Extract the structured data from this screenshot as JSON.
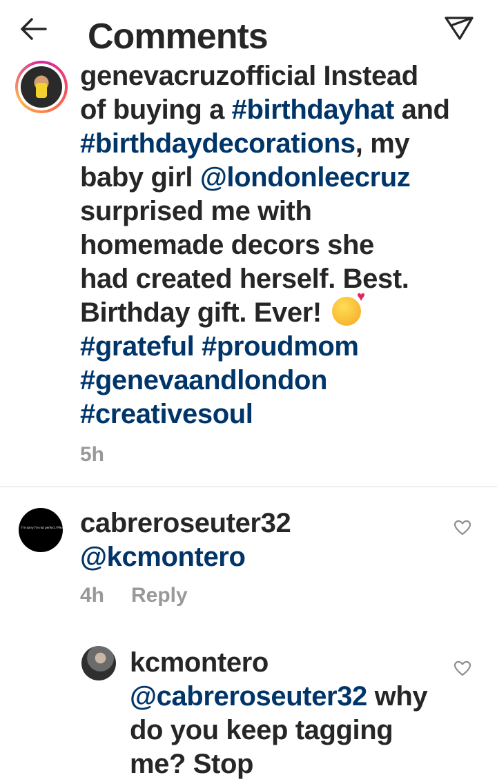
{
  "header": {
    "title": "Comments",
    "back_icon": "arrow-left-icon",
    "share_icon": "paper-plane-icon"
  },
  "caption": {
    "lines": [
      [
        {
          "t": "genevacruzofficial Instead",
          "tag": false
        }
      ],
      [
        {
          "t": "of buying a ",
          "tag": false
        },
        {
          "t": "#birthdayhat",
          "tag": true
        },
        {
          "t": " and",
          "tag": false
        }
      ],
      [
        {
          "t": "#birthdaydecorations",
          "tag": true
        },
        {
          "t": ", my",
          "tag": false
        }
      ],
      [
        {
          "t": "baby girl ",
          "tag": false
        },
        {
          "t": "@londonleecruz",
          "tag": true
        }
      ],
      [
        {
          "t": "surprised me with",
          "tag": false
        }
      ],
      [
        {
          "t": "homemade decors she",
          "tag": false
        }
      ],
      [
        {
          "t": "had created herself. Best.",
          "tag": false
        }
      ],
      [
        {
          "t": "Birthday gift. Ever! ",
          "tag": false
        },
        {
          "emoji": "smiling-face-with-hearts-icon"
        }
      ],
      [
        {
          "t": "#grateful",
          "tag": true
        },
        {
          "t": " ",
          "tag": false
        },
        {
          "t": "#proudmom",
          "tag": true
        }
      ],
      [
        {
          "t": "#genevaandlondon",
          "tag": true
        }
      ],
      [
        {
          "t": "#creativesoul",
          "tag": true
        }
      ]
    ],
    "time": "5h"
  },
  "comments": [
    {
      "username": "cabreroseuter32",
      "mention": "@kcmontero",
      "time": "4h",
      "reply_label": "Reply",
      "avatar_text": "I'm sorry I'm not perfect / Please forgive me"
    },
    {
      "username": "kcmontero",
      "lines": [
        [
          {
            "t": "@cabreroseuter32",
            "tag": true
          },
          {
            "t": " why",
            "tag": false
          }
        ],
        [
          {
            "t": "do you keep tagging",
            "tag": false
          }
        ],
        [
          {
            "t": "me? Stop",
            "tag": false
          }
        ]
      ]
    }
  ],
  "colors": {
    "text": "#262626",
    "link": "#003569",
    "meta": "#999999",
    "divider": "#dbdbdb"
  }
}
